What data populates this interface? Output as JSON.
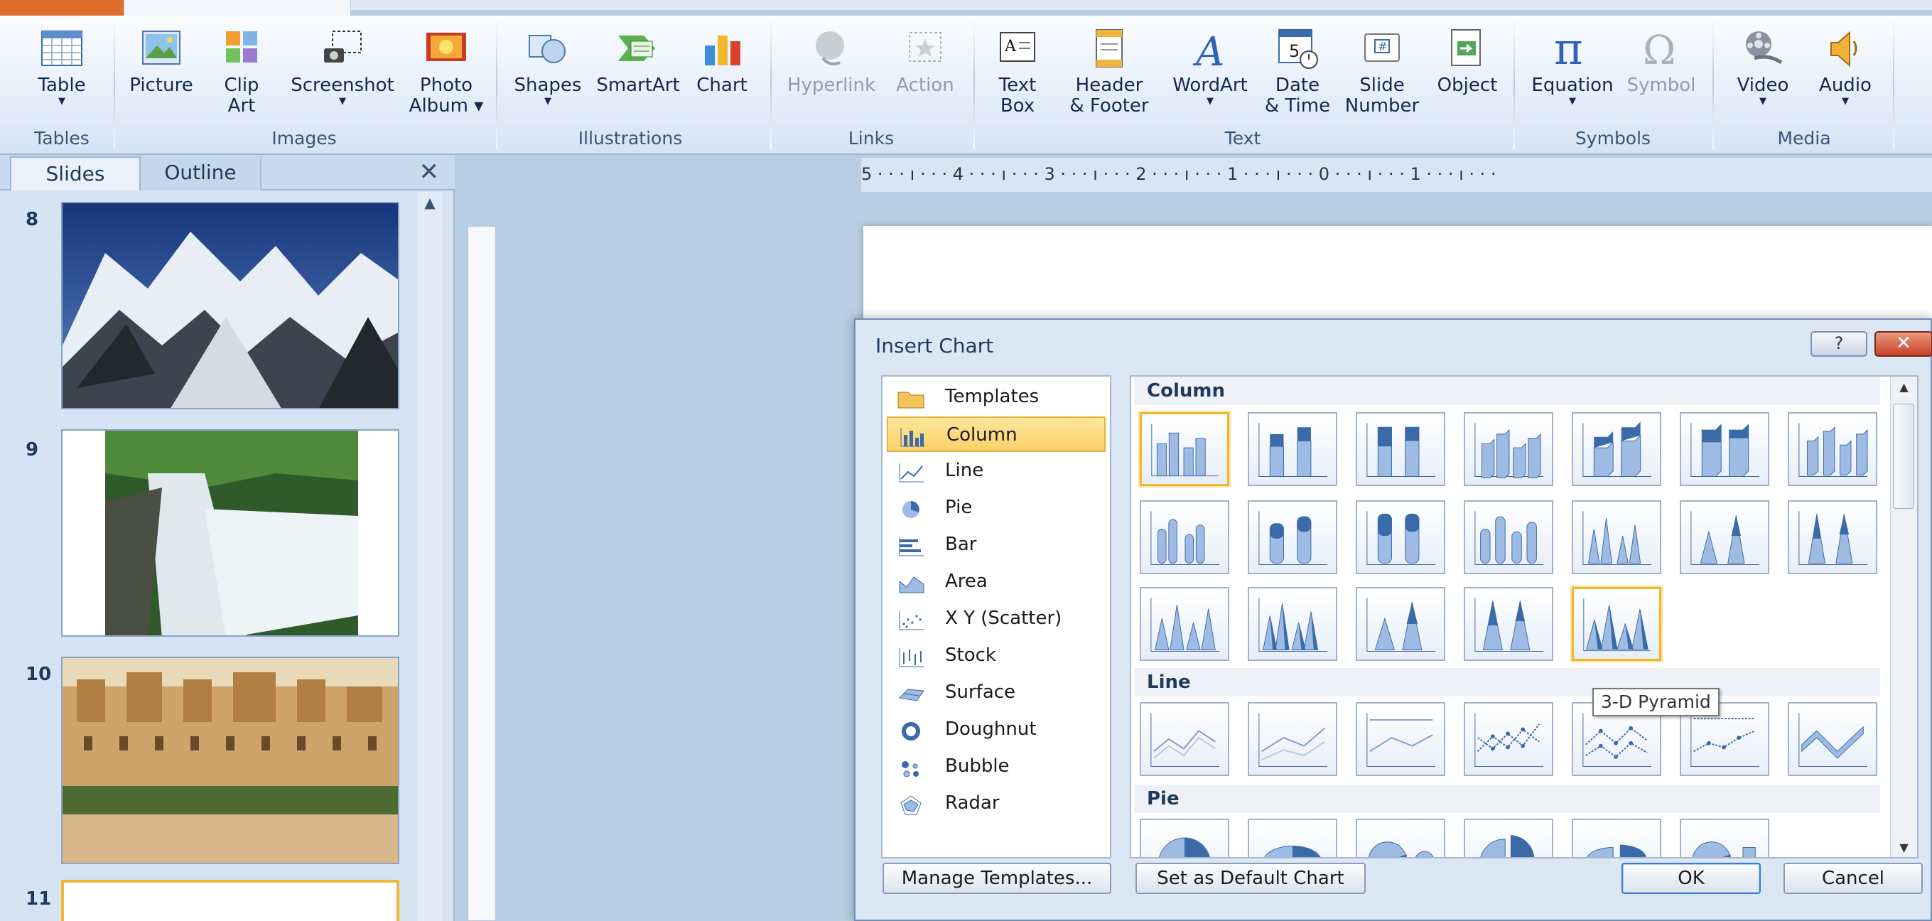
{
  "ribbon": {
    "buttons": [
      {
        "id": "table",
        "label": "Table",
        "icon": "table-icon",
        "arrow": true
      },
      {
        "id": "picture",
        "label": "Picture",
        "icon": "picture-icon"
      },
      {
        "id": "clipart",
        "label": "Clip\nArt",
        "icon": "clip-art-icon"
      },
      {
        "id": "screenshot",
        "label": "Screenshot",
        "icon": "screenshot-icon",
        "arrow": true
      },
      {
        "id": "photoalbum",
        "label": "Photo\nAlbum ▾",
        "icon": "photo-album-icon"
      },
      {
        "id": "shapes",
        "label": "Shapes",
        "icon": "shapes-icon",
        "arrow": true
      },
      {
        "id": "smartart",
        "label": "SmartArt",
        "icon": "smartart-icon"
      },
      {
        "id": "chart",
        "label": "Chart",
        "icon": "chart-icon"
      },
      {
        "id": "hyperlink",
        "label": "Hyperlink",
        "icon": "hyperlink-icon",
        "disabled": true
      },
      {
        "id": "action",
        "label": "Action",
        "icon": "action-icon",
        "disabled": true
      },
      {
        "id": "textbox",
        "label": "Text\nBox",
        "icon": "text-box-icon"
      },
      {
        "id": "headerfooter",
        "label": "Header\n& Footer",
        "icon": "header-footer-icon"
      },
      {
        "id": "wordart",
        "label": "WordArt",
        "icon": "wordart-icon",
        "arrow": true
      },
      {
        "id": "datetime",
        "label": "Date\n& Time",
        "icon": "date-time-icon"
      },
      {
        "id": "slidenumber",
        "label": "Slide\nNumber",
        "icon": "slide-number-icon"
      },
      {
        "id": "object",
        "label": "Object",
        "icon": "object-icon"
      },
      {
        "id": "equation",
        "label": "Equation",
        "icon": "equation-icon",
        "arrow": true
      },
      {
        "id": "symbol",
        "label": "Symbol",
        "icon": "symbol-icon",
        "disabled": true
      },
      {
        "id": "video",
        "label": "Video",
        "icon": "video-icon",
        "arrow": true
      },
      {
        "id": "audio",
        "label": "Audio",
        "icon": "audio-icon",
        "arrow": true
      }
    ],
    "groups": [
      "Tables",
      "Images",
      "Illustrations",
      "Links",
      "Text",
      "Symbols",
      "Media"
    ]
  },
  "leftpanel": {
    "tabs": {
      "slides": "Slides",
      "outline": "Outline"
    },
    "close": "✕",
    "slide_numbers": [
      "8",
      "9",
      "10",
      "11"
    ]
  },
  "ruler": {
    "text": "5 · · · ı · · · 4 · · · ı · · · 3 · · · ı · · · 2 · · · ı · · · 1 · · · ı · · · 0 · · · ı · · · 1 · · · ı · · ·"
  },
  "dialog": {
    "title": "Insert Chart",
    "help": "?",
    "close": "✕",
    "categories": [
      "Templates",
      "Column",
      "Line",
      "Pie",
      "Bar",
      "Area",
      "X Y (Scatter)",
      "Stock",
      "Surface",
      "Doughnut",
      "Bubble",
      "Radar"
    ],
    "selected_category": "Column",
    "sections": {
      "column": "Column",
      "line": "Line",
      "pie": "Pie"
    },
    "tooltip": "3-D Pyramid",
    "buttons": {
      "manage": "Manage Templates...",
      "setdefault": "Set as Default Chart",
      "ok": "OK",
      "cancel": "Cancel"
    }
  },
  "colors": {
    "accent": "#f2b630",
    "ribbon_bg": "#e4eefa",
    "panel_bg": "#d6e3f3",
    "close_red": "#c8412a"
  }
}
